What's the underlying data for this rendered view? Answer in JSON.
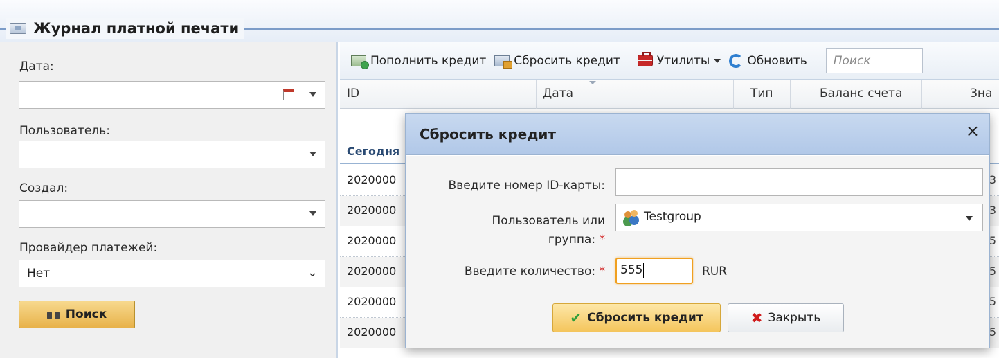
{
  "window": {
    "title": "Журнал платной печати"
  },
  "filters": {
    "date_label": "Дата:",
    "date_value": "",
    "user_label": "Пользователь:",
    "user_value": "",
    "created_label": "Создал:",
    "created_value": "",
    "provider_label": "Провайдер платежей:",
    "provider_value": "Нет",
    "search_button": "Поиск"
  },
  "toolbar": {
    "add_credit": "Пополнить кредит",
    "reset_credit": "Сбросить кредит",
    "utilities": "Утилиты",
    "refresh": "Обновить",
    "search_placeholder": "Поиск"
  },
  "grid": {
    "columns": [
      "ID",
      "Дата",
      "Тип",
      "Баланс счета",
      "Зна"
    ],
    "group_label": "Сегодня",
    "rows": [
      {
        "id": "2020000",
        "right": "3"
      },
      {
        "id": "2020000",
        "right": "3"
      },
      {
        "id": "2020000",
        "right": "5"
      },
      {
        "id": "2020000",
        "right": "5"
      },
      {
        "id": "2020000",
        "right": "5"
      },
      {
        "id": "2020000",
        "right": "5"
      }
    ]
  },
  "dialog": {
    "title": "Сбросить кредит",
    "close_glyph": "×",
    "card_label": "Введите номер ID-карты:",
    "card_value": "",
    "user_label_1": "Пользователь или",
    "user_label_2": "группа:",
    "user_value": "Testgroup",
    "amount_label": "Введите количество:",
    "amount_value": "555",
    "currency": "RUR",
    "required_mark": "*",
    "submit_button": "Сбросить кредит",
    "close_button": "Закрыть"
  },
  "icons": {
    "titlebar": "card-icon",
    "calendar": "calendar-icon",
    "search": "binoculars-icon",
    "add_credit": "money-add-icon",
    "reset_credit": "money-reset-icon",
    "utilities": "toolbox-icon",
    "refresh": "refresh-icon",
    "user_group": "user-group-icon",
    "check": "check-icon",
    "close": "x-icon"
  },
  "colors": {
    "accent_button": "#f4c55c",
    "dialog_header": "#b1c8e8",
    "required": "#d01c1c",
    "focus_border": "#f0a020"
  }
}
